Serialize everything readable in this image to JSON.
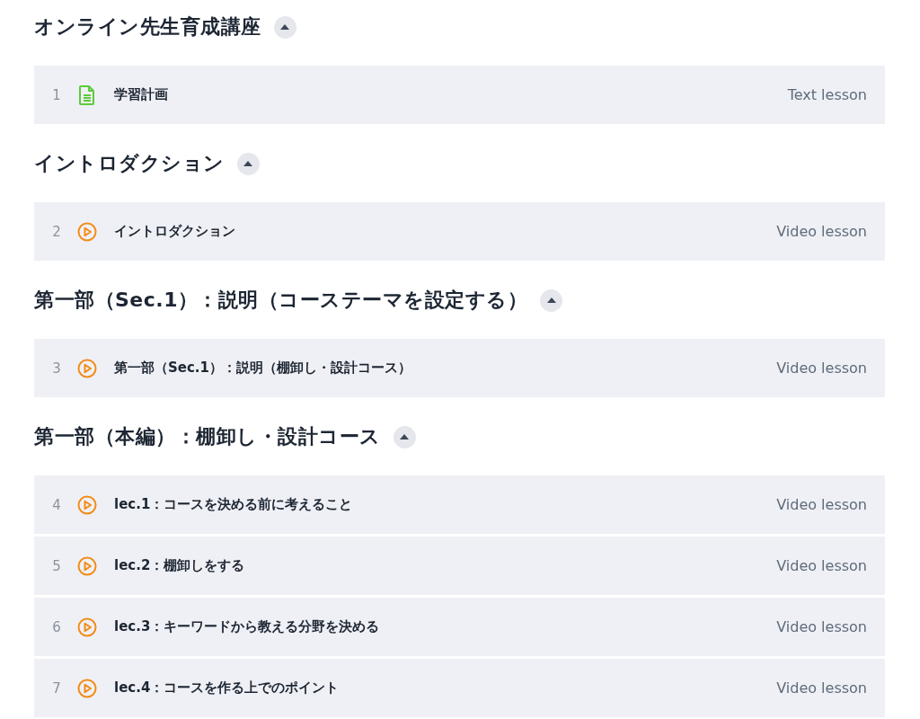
{
  "sections": [
    {
      "title": "オンライン先生育成講座",
      "expanded": true,
      "lessons": [
        {
          "number": "1",
          "kind": "text",
          "title": "学習計画",
          "type": "Text lesson"
        }
      ]
    },
    {
      "title": "イントロダクション",
      "expanded": true,
      "lessons": [
        {
          "number": "2",
          "kind": "video",
          "title": "イントロダクション",
          "type": "Video lesson"
        }
      ]
    },
    {
      "title": "第一部（Sec.1）：説明（コーステーマを設定する）",
      "expanded": true,
      "lessons": [
        {
          "number": "3",
          "kind": "video",
          "title": "第一部（Sec.1）：説明（棚卸し・設計コース）",
          "type": "Video lesson"
        }
      ]
    },
    {
      "title": "第一部（本編）：棚卸し・設計コース",
      "expanded": true,
      "lessons": [
        {
          "number": "4",
          "kind": "video",
          "title": "lec.1：コースを決める前に考えること",
          "type": "Video lesson"
        },
        {
          "number": "5",
          "kind": "video",
          "title": "lec.2：棚卸しをする",
          "type": "Video lesson"
        },
        {
          "number": "6",
          "kind": "video",
          "title": "lec.3：キーワードから教える分野を決める",
          "type": "Video lesson"
        },
        {
          "number": "7",
          "kind": "video",
          "title": "lec.4：コースを作る上でのポイント",
          "type": "Video lesson"
        }
      ]
    }
  ]
}
